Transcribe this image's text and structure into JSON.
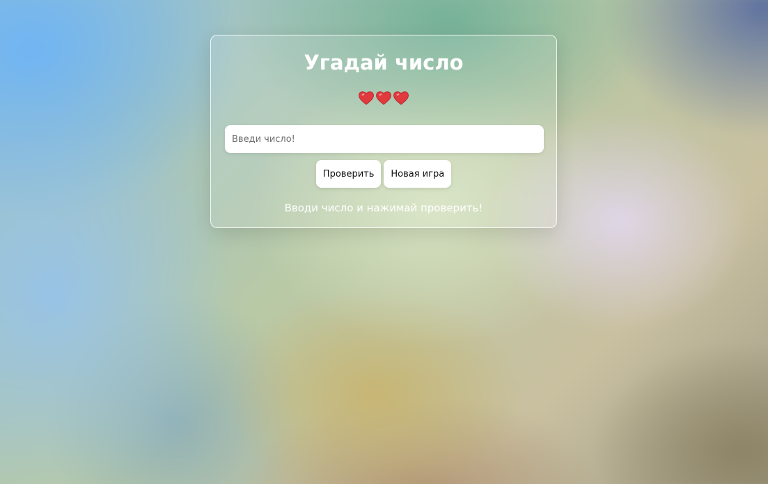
{
  "game": {
    "title": "Угадай число",
    "lives": 3,
    "heart_color": "#e0393e",
    "input_placeholder": "Введи число!",
    "input_value": "",
    "check_button": "Проверить",
    "new_game_button": "Новая игра",
    "message": "Вводи число и нажимай проверить!"
  }
}
